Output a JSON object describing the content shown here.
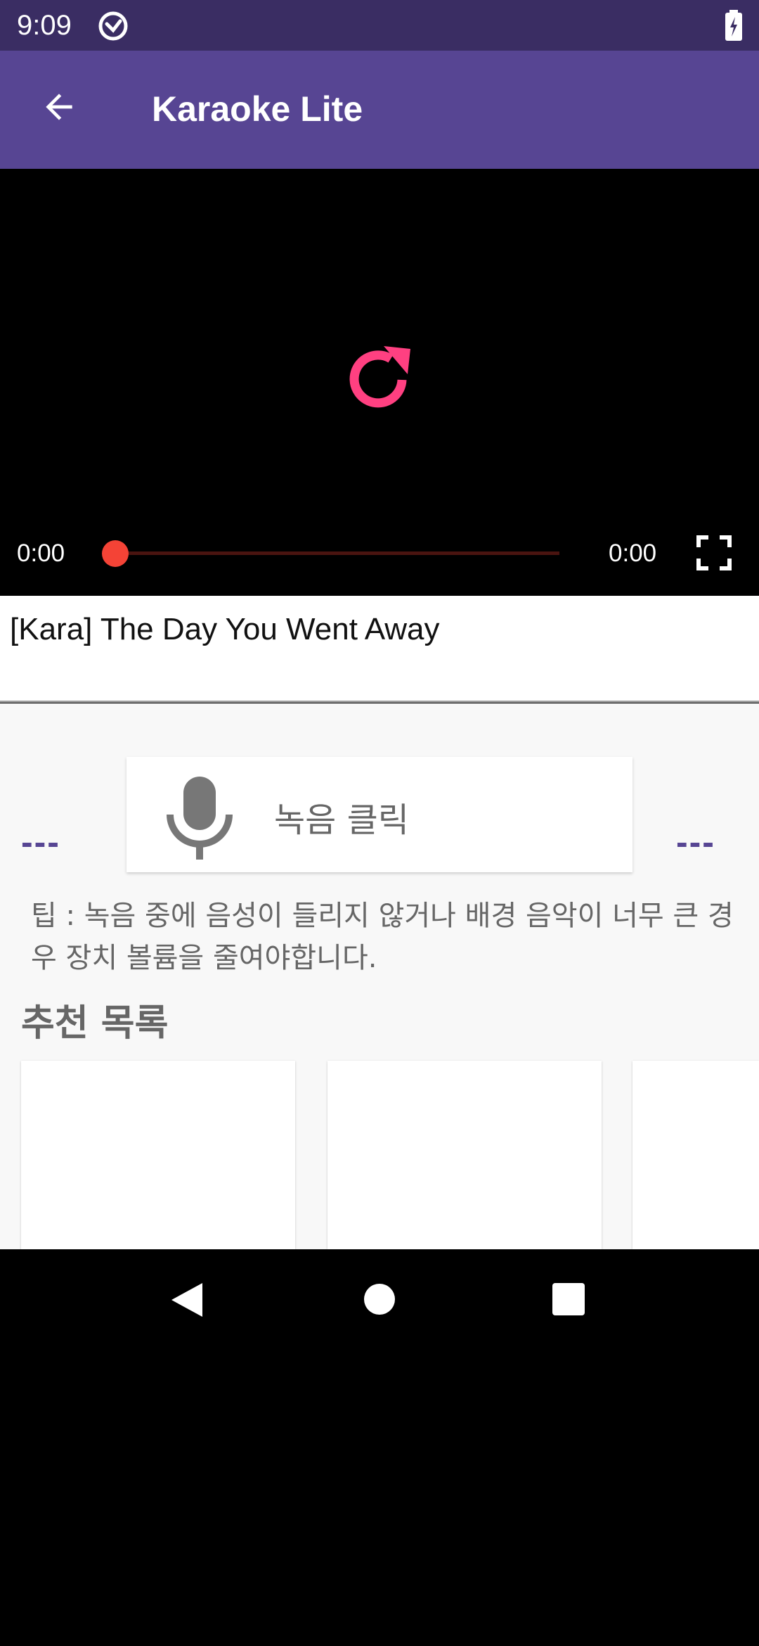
{
  "status_bar": {
    "time": "9:09"
  },
  "app_bar": {
    "title": "Karaoke Lite"
  },
  "player": {
    "current_time": "0:00",
    "total_time": "0:00",
    "progress": 0
  },
  "song": {
    "title": "[Kara] The Day You Went Away"
  },
  "record": {
    "label": "녹음 클릭",
    "dash_left": "---",
    "dash_right": "---"
  },
  "tip": {
    "text": "팁 : 녹음 중에 음성이 들리지 않거나 배경 음악이 너무 큰 경우 장치 볼륨을 줄여야합니다."
  },
  "recommended": {
    "title": "추천 목록"
  },
  "colors": {
    "primary": "#574593",
    "status_bar": "#3a2d63",
    "accent": "#ff4081",
    "seek": "#f44336"
  },
  "icons": [
    "sync-icon",
    "battery-charging-icon",
    "arrow-back-icon",
    "replay-icon",
    "fullscreen-icon",
    "mic-icon",
    "nav-back-icon",
    "nav-home-icon",
    "nav-recents-icon"
  ]
}
